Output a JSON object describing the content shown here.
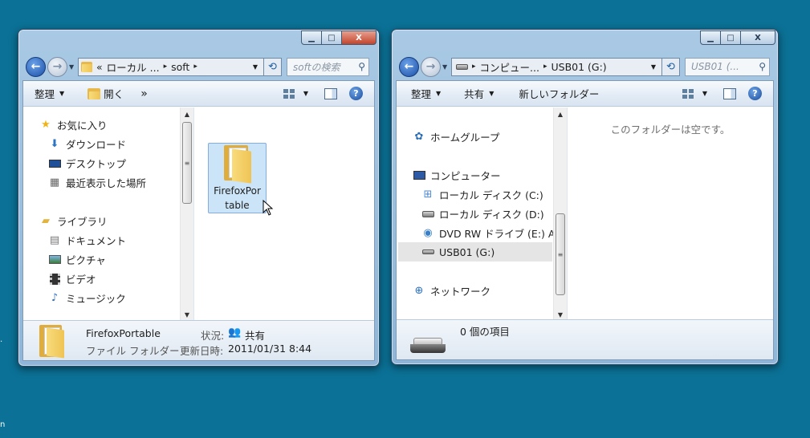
{
  "left_window": {
    "caption": {
      "minimize": "▁",
      "maximize": "□",
      "close": "X"
    },
    "address": {
      "prefix": "«",
      "seg1": "ローカル ...",
      "seg2": "soft",
      "sep": "▸"
    },
    "search_placeholder": "softの検索",
    "toolbar": {
      "organize": "整理",
      "open": "開く",
      "more": "»"
    },
    "nav": {
      "favorites": "お気に入り",
      "downloads": "ダウンロード",
      "desktop": "デスクトップ",
      "recent": "最近表示した場所",
      "libraries": "ライブラリ",
      "documents": "ドキュメント",
      "pictures": "ピクチャ",
      "videos": "ビデオ",
      "music": "ミュージック"
    },
    "folder_item": {
      "name_line1": "FirefoxPor",
      "name_line2": "table"
    },
    "details": {
      "name": "FirefoxPortable",
      "type": "ファイル フォルダー",
      "status_label": "状況:",
      "status_value": "共有",
      "modified_label": "更新日時:",
      "modified_value": "2011/01/31 8:44"
    }
  },
  "right_window": {
    "caption": {
      "minimize": "▁",
      "maximize": "□",
      "close": "X"
    },
    "address": {
      "seg1": "コンピュー...",
      "seg2": "USB01 (G:)",
      "sep": "▸"
    },
    "search_placeholder": "USB01 (...",
    "toolbar": {
      "organize": "整理",
      "share": "共有",
      "new_folder": "新しいフォルダー"
    },
    "nav": {
      "homegroup": "ホームグループ",
      "computer": "コンピューター",
      "drive_c": "ローカル ディスク (C:)",
      "drive_d": "ローカル ディスク (D:)",
      "drive_e": "DVD RW ドライブ (E:) A",
      "drive_g": "USB01 (G:)",
      "network": "ネットワーク"
    },
    "empty_message": "このフォルダーは空です。",
    "details": {
      "item_count": "0 個の項目"
    }
  },
  "colors": {
    "desktop": "#0b7196",
    "selection": "#cce4f7",
    "nav_selected": "#e5e5e5"
  }
}
